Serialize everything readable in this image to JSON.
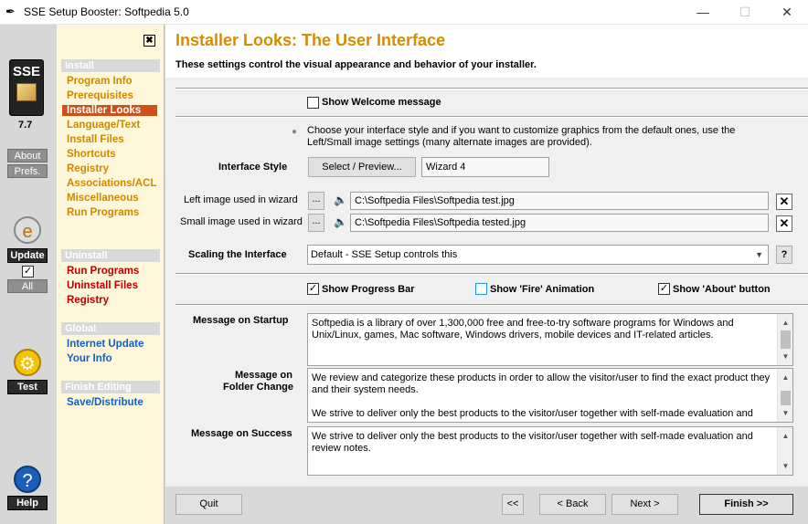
{
  "window": {
    "title": "SSE Setup Booster: Softpedia 5.0",
    "minimize": "—",
    "maximize": "☐",
    "close": "✕"
  },
  "iconbar": {
    "logo_text": "SSE",
    "version": "7.7",
    "about": "About",
    "prefs": "Prefs.",
    "update": "Update",
    "all": "All",
    "test": "Test",
    "help": "Help"
  },
  "nav": {
    "close": "✖",
    "install_header": "Install",
    "install_items": [
      "Program Info",
      "Prerequisites",
      "Installer Looks",
      "Language/Text",
      "Install Files",
      "Shortcuts",
      "Registry",
      "Associations/ACL",
      "Miscellaneous",
      "Run Programs"
    ],
    "uninstall_header": "Uninstall",
    "uninstall_items": [
      "Run Programs",
      "Uninstall Files",
      "Registry"
    ],
    "global_header": "Global",
    "global_items": [
      "Internet Update",
      "Your Info"
    ],
    "finish_header": "Finish Editing",
    "finish_items": [
      "Save/Distribute"
    ]
  },
  "page": {
    "title": "Installer Looks: The User Interface",
    "subtitle": "These settings control the visual appearance and behavior of your installer.",
    "show_welcome": "Show Welcome message",
    "style_hint_1": "Choose your interface style and if you want to customize graphics from the default ones, use the",
    "style_hint_2": "Left/Small image settings (many alternate images are provided).",
    "interface_style_label": "Interface Style",
    "select_preview": "Select / Preview...",
    "interface_style_value": "Wizard 4",
    "left_image_label": "Left image used in wizard",
    "left_image_path": "C:\\Softpedia Files\\Softpedia test.jpg",
    "small_image_label": "Small image used in wizard",
    "small_image_path": "C:\\Softpedia Files\\Softpedia tested.jpg",
    "browse": "...",
    "clear": "✕",
    "scaling_label": "Scaling the Interface",
    "scaling_value": "Default - SSE Setup controls this",
    "help_q": "?",
    "show_progress": "Show Progress Bar",
    "show_fire": "Show 'Fire' Animation",
    "show_about": "Show 'About' button",
    "msg_startup_label": "Message on Startup",
    "msg_startup": "Softpedia is a library of over 1,300,000 free and free-to-try software programs for Windows and Unix/Linux, games, Mac software, Windows drivers, mobile devices and IT-related articles.",
    "msg_folder_label_1": "Message on",
    "msg_folder_label_2": "Folder Change",
    "msg_folder_p1": "We review and categorize these products in order to allow the visitor/user to find the exact product they and their system needs.",
    "msg_folder_p2": "We strive to deliver only the best products to the visitor/user together with self-made evaluation and",
    "msg_success_label": "Message on Success",
    "msg_success": "We strive to deliver only the best products to the visitor/user together with self-made evaluation and review notes."
  },
  "footer": {
    "quit": "Quit",
    "first": "<<",
    "back": "< Back",
    "next": "Next >",
    "finish": "Finish >>"
  },
  "checks": {
    "show_welcome": false,
    "show_progress": true,
    "show_fire": false,
    "show_about": true,
    "update_all": true
  }
}
